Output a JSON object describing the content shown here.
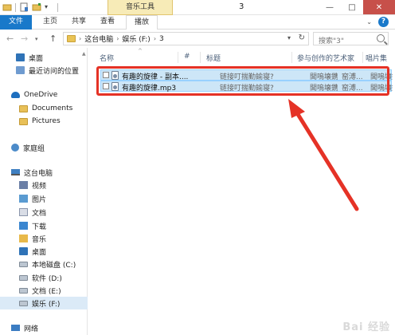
{
  "window": {
    "title": "3",
    "tool_tab_header": "音乐工具",
    "minimize": "—",
    "maximize": "□",
    "close": "✕"
  },
  "ribbon": {
    "tabs": [
      {
        "label": "文件"
      },
      {
        "label": "主页"
      },
      {
        "label": "共享"
      },
      {
        "label": "查看"
      },
      {
        "label": "播放"
      }
    ],
    "collapse": "⌄",
    "help": "?"
  },
  "addressbar": {
    "back": "←",
    "forward": "→",
    "recent_dropdown": "▾",
    "up": "↑",
    "crumbs": [
      "这台电脑",
      "娱乐 (F:)",
      "3"
    ],
    "crumb_sep": "›",
    "dropdown": "▾",
    "refresh": "↻",
    "search_placeholder": "搜索\"3\""
  },
  "navpane": {
    "items": [
      {
        "label": "桌面",
        "icon": "desktop-icon"
      },
      {
        "label": "最近访问的位置",
        "icon": "recent-places-icon"
      },
      {
        "label": "OneDrive",
        "icon": "onedrive-icon"
      },
      {
        "label": "Documents",
        "icon": "folder-icon"
      },
      {
        "label": "Pictures",
        "icon": "folder-icon"
      },
      {
        "label": "家庭组",
        "icon": "homegroup-icon"
      },
      {
        "label": "这台电脑",
        "icon": "computer-icon"
      },
      {
        "label": "视频",
        "icon": "videos-icon"
      },
      {
        "label": "图片",
        "icon": "pictures-icon"
      },
      {
        "label": "文档",
        "icon": "documents-icon"
      },
      {
        "label": "下载",
        "icon": "downloads-icon"
      },
      {
        "label": "音乐",
        "icon": "music-icon"
      },
      {
        "label": "桌面",
        "icon": "desktop-icon"
      },
      {
        "label": "本地磁盘 (C:)",
        "icon": "drive-icon"
      },
      {
        "label": "软件 (D:)",
        "icon": "drive-icon"
      },
      {
        "label": "文档 (E:)",
        "icon": "drive-icon"
      },
      {
        "label": "娱乐 (F:)",
        "icon": "drive-icon"
      },
      {
        "label": "网络",
        "icon": "network-icon"
      }
    ]
  },
  "filelist": {
    "columns": [
      "名称",
      "#",
      "标题",
      "参与创作的艺术家",
      "唱片集"
    ],
    "sort_indicator": "^",
    "rows": [
      {
        "name": "有趣的旋律 - 副本....",
        "title": "链接叮揣勤鍮寝?",
        "artist": "閭嗚壊鎸勤",
        "artist2": "窑溥...",
        "album": "閭嗚壊鎸"
      },
      {
        "name": "有趣的旋律.mp3",
        "title": "链接叮揣勤鍮寝?",
        "artist": "閭嗚壊鎸勤",
        "artist2": "窑溥...",
        "album": "閭嗚壊鎸"
      }
    ]
  },
  "colors": {
    "file_tab": "#1979ca",
    "selection": "#cde6f7",
    "highlight_box": "#e53226",
    "tool_tab": "#f7ebb7"
  },
  "watermark": "Bai 经验"
}
